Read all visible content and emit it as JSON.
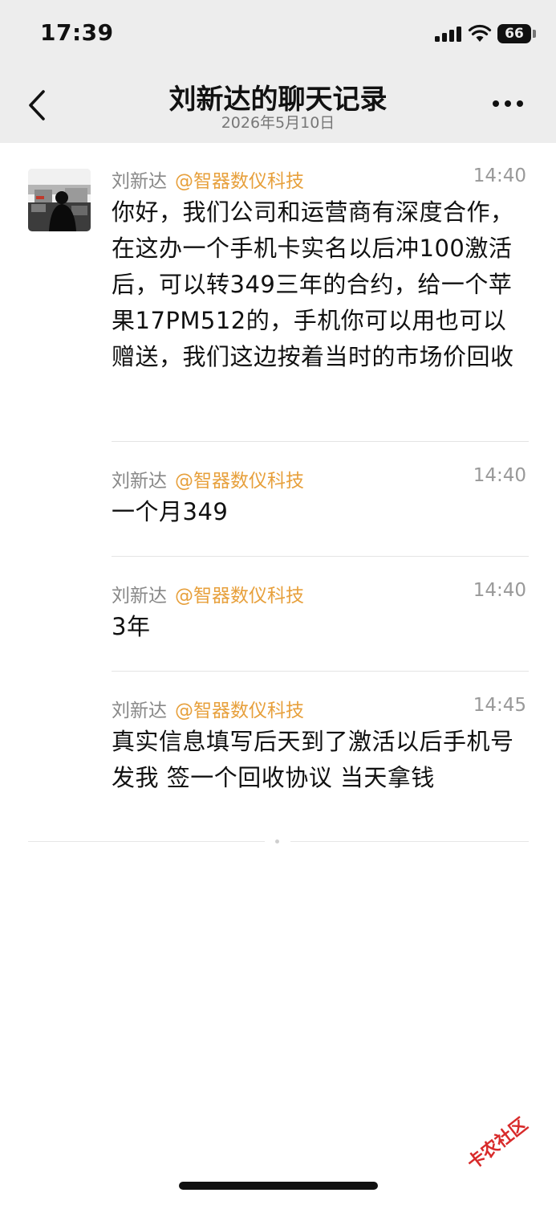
{
  "status_bar": {
    "time": "17:39",
    "battery": "66"
  },
  "header": {
    "title": "刘新达的聊天记录",
    "subtitle": "2026年5月10日"
  },
  "icons": {
    "back": "chevron-left-icon",
    "more": "more-horizontal-icon",
    "signal": "cellular-signal-icon",
    "wifi": "wifi-icon",
    "battery": "battery-icon"
  },
  "messages": [
    {
      "sender": "刘新达",
      "mention": "@智器数仪科技",
      "time": "14:40",
      "text": "你好，我们公司和运营商有深度合作，在这办一个手机卡实名以后冲100激活后，可以转349三年的合约，给一个苹果17PM512的，手机你可以用也可以赠送，我们这边按着当时的市场价回收"
    },
    {
      "sender": "刘新达",
      "mention": "@智器数仪科技",
      "time": "14:40",
      "text": "一个月349"
    },
    {
      "sender": "刘新达",
      "mention": "@智器数仪科技",
      "time": "14:40",
      "text": "3年"
    },
    {
      "sender": "刘新达",
      "mention": "@智器数仪科技",
      "time": "14:45",
      "text": "真实信息填写后天到了激活以后手机号发我 签一个回收协议 当天拿钱"
    }
  ],
  "watermark": "卡农社区",
  "colors": {
    "mention": "#e7a03c",
    "header_bg": "#ededed",
    "watermark": "#d82a2a"
  }
}
